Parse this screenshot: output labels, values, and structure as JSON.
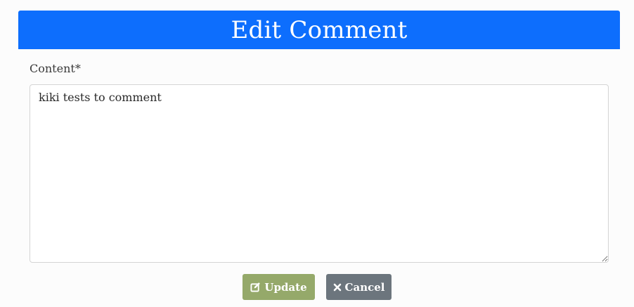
{
  "header": {
    "title": "Edit Comment"
  },
  "form": {
    "content_label": "Content*",
    "content_value": "kiki tests to comment"
  },
  "actions": {
    "update_label": "Update",
    "update_icon": "edit-icon",
    "cancel_label": "Cancel",
    "cancel_icon": "close-icon"
  },
  "colors": {
    "header_bg": "#0d6efd",
    "update_bg": "#95a96a",
    "cancel_bg": "#6c757d"
  }
}
